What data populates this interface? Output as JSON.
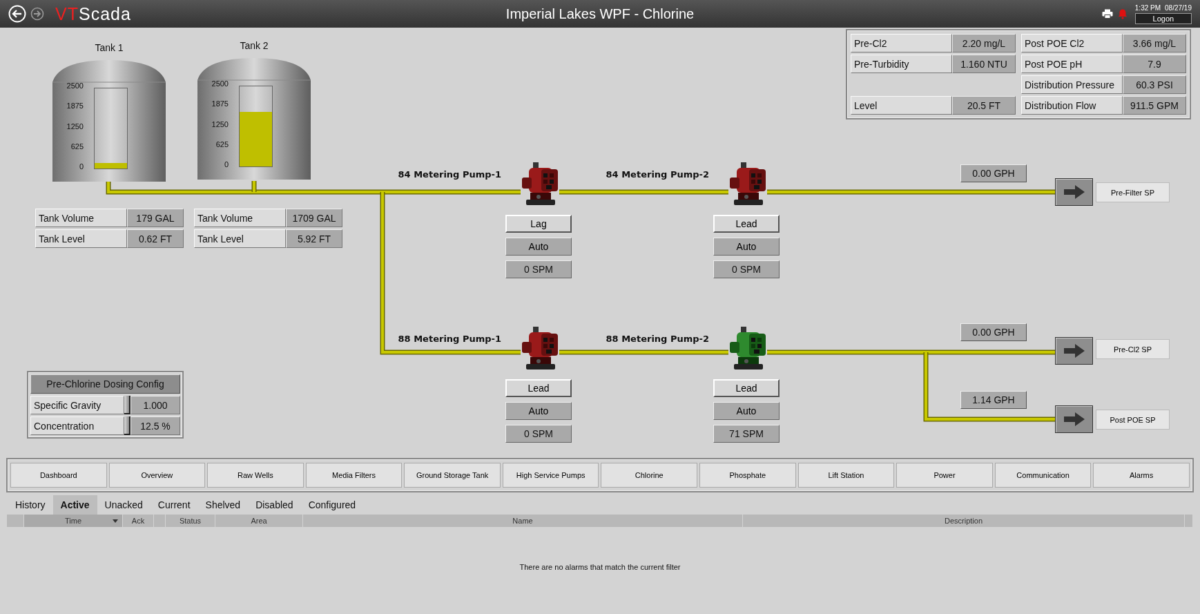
{
  "header": {
    "logo_accent": "VT",
    "logo_rest": "Scada",
    "title": "Imperial Lakes WPF - Chlorine",
    "time": "1:32 PM",
    "date": "08/27/19",
    "logon": "Logon"
  },
  "tanks": [
    {
      "name": "Tank 1",
      "scale": [
        "2500",
        "1875",
        "1250",
        "625",
        "0"
      ],
      "level": 0.07,
      "rows": [
        {
          "label": "Tank Volume",
          "value": "179 GAL"
        },
        {
          "label": "Tank Level",
          "value": "0.62 FT"
        }
      ]
    },
    {
      "name": "Tank 2",
      "scale": [
        "2500",
        "1875",
        "1250",
        "625",
        "0"
      ],
      "level": 0.68,
      "rows": [
        {
          "label": "Tank Volume",
          "value": "1709 GAL"
        },
        {
          "label": "Tank Level",
          "value": "5.92 FT"
        }
      ]
    }
  ],
  "readings": [
    {
      "left": {
        "label": "Pre-Cl2",
        "value": "2.20 mg/L"
      },
      "right": {
        "label": "Post POE Cl2",
        "value": "3.66 mg/L"
      }
    },
    {
      "left": {
        "label": "Pre-Turbidity",
        "value": "1.160 NTU"
      },
      "right": {
        "label": "Post POE pH",
        "value": "7.9"
      }
    },
    {
      "right": {
        "label": "Distribution Pressure",
        "value": "60.3 PSI"
      }
    },
    {
      "left": {
        "label": "Level",
        "value": "20.5 FT"
      },
      "right": {
        "label": "Distribution Flow",
        "value": "911.5 GPM"
      }
    }
  ],
  "pumps": [
    {
      "name": "84 Metering Pump-1",
      "running": false,
      "role": "Lag",
      "mode": "Auto",
      "rate": "0 SPM"
    },
    {
      "name": "84 Metering Pump-2",
      "running": false,
      "role": "Lead",
      "mode": "Auto",
      "rate": "0 SPM"
    },
    {
      "name": "88 Metering Pump-1",
      "running": false,
      "role": "Lead",
      "mode": "Auto",
      "rate": "0 SPM"
    },
    {
      "name": "88 Metering Pump-2",
      "running": true,
      "role": "Lead",
      "mode": "Auto",
      "rate": "71 SPM"
    }
  ],
  "outlets": [
    {
      "flow": "0.00 GPH",
      "target": "Pre-Filter SP"
    },
    {
      "flow": "0.00 GPH",
      "target": "Pre-Cl2 SP"
    },
    {
      "flow": "1.14 GPH",
      "target": "Post POE SP"
    }
  ],
  "dosing_config": {
    "title": "Pre-Chlorine Dosing Config",
    "rows": [
      {
        "label": "Specific Gravity",
        "value": "1.000"
      },
      {
        "label": "Concentration",
        "value": "12.5 %"
      }
    ]
  },
  "nav": [
    "Dashboard",
    "Overview",
    "Raw Wells",
    "Media Filters",
    "Ground Storage Tank",
    "High Service Pumps",
    "Chlorine",
    "Phosphate",
    "Lift Station",
    "Power",
    "Communication",
    "Alarms"
  ],
  "alarm_tabs": [
    {
      "label": "History",
      "selected": false
    },
    {
      "label": "Active",
      "selected": true
    },
    {
      "label": "Unacked",
      "selected": false
    },
    {
      "label": "Current",
      "selected": false
    },
    {
      "label": "Shelved",
      "selected": false
    },
    {
      "label": "Disabled",
      "selected": false
    },
    {
      "label": "Configured",
      "selected": false
    }
  ],
  "alarm_table": {
    "columns": [
      {
        "label": "Time",
        "sorted": true
      },
      {
        "label": "Ack",
        "sorted": false
      },
      {
        "label": "Status",
        "sorted": false
      },
      {
        "label": "Area",
        "sorted": false
      },
      {
        "label": "Name",
        "sorted": false
      },
      {
        "label": "Description",
        "sorted": false
      }
    ],
    "empty_message": "There are no alarms that match the current filter"
  }
}
